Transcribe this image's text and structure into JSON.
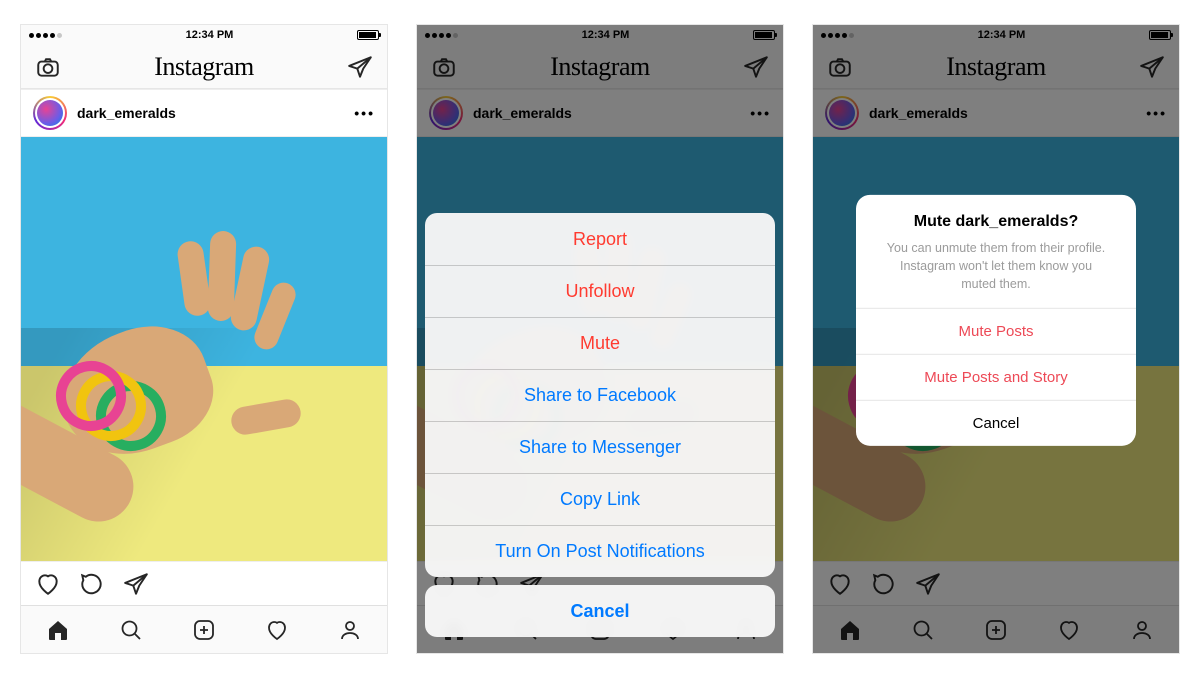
{
  "status": {
    "time": "12:34 PM"
  },
  "header": {
    "logo": "Instagram"
  },
  "post": {
    "username": "dark_emeralds"
  },
  "actionSheet": {
    "items": [
      {
        "label": "Report",
        "style": "destructive"
      },
      {
        "label": "Unfollow",
        "style": "destructive"
      },
      {
        "label": "Mute",
        "style": "destructive"
      },
      {
        "label": "Share to Facebook",
        "style": "link"
      },
      {
        "label": "Share to Messenger",
        "style": "link"
      },
      {
        "label": "Copy Link",
        "style": "link"
      },
      {
        "label": "Turn On Post Notifications",
        "style": "link"
      }
    ],
    "cancel": "Cancel"
  },
  "muteDialog": {
    "title": "Mute dark_emeralds?",
    "body": "You can unmute them from their profile. Instagram won't let them know you muted them.",
    "options": [
      {
        "label": "Mute Posts",
        "style": "red"
      },
      {
        "label": "Mute Posts and Story",
        "style": "red"
      },
      {
        "label": "Cancel",
        "style": "plain"
      }
    ]
  }
}
